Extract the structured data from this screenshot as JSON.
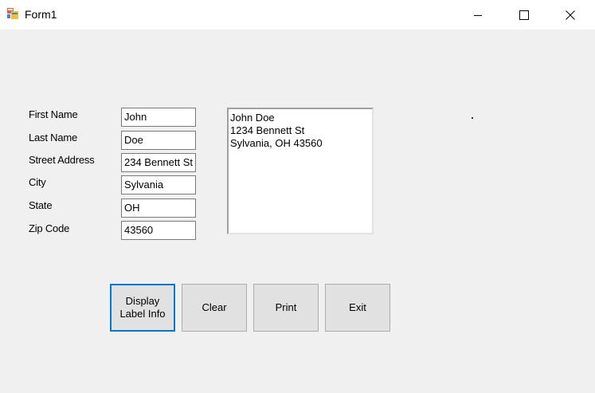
{
  "window": {
    "title": "Form1"
  },
  "form": {
    "labels": {
      "first_name": "First Name",
      "last_name": "Last Name",
      "street": "Street Address",
      "city": "City",
      "state": "State",
      "zip": "Zip Code"
    },
    "values": {
      "first_name": "John",
      "last_name": "Doe",
      "street": "234 Bennett St",
      "city": "Sylvania",
      "state": "OH",
      "zip": "43560"
    }
  },
  "label_output": {
    "lines": [
      "John Doe",
      "1234 Bennett St",
      "Sylvania, OH 43560"
    ]
  },
  "buttons": {
    "display_line1": "Display",
    "display_line2": "Label Info",
    "clear": "Clear",
    "print": "Print",
    "exit": "Exit"
  }
}
